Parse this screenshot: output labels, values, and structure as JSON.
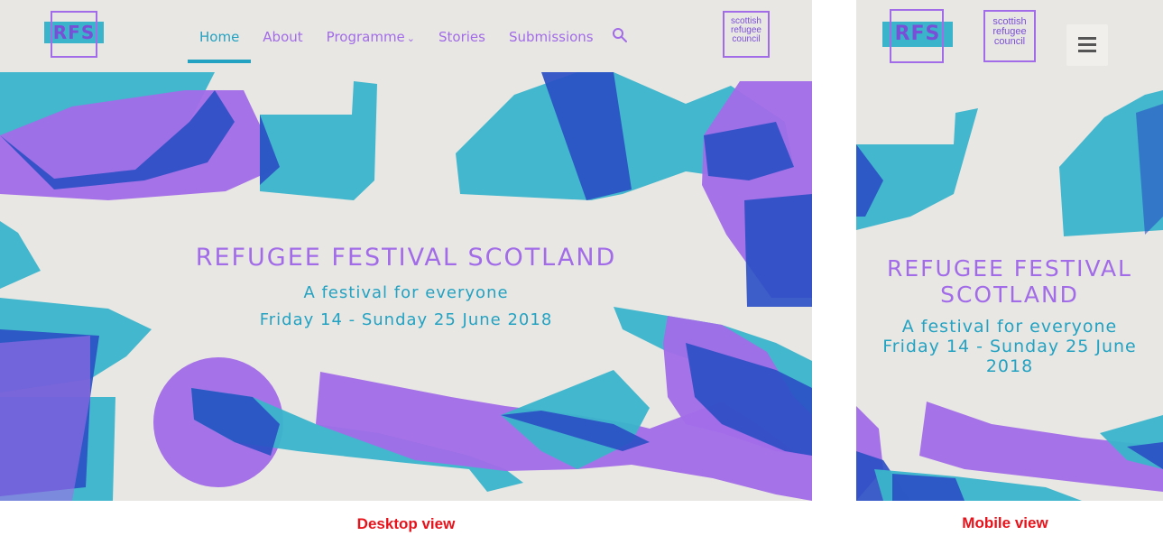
{
  "desktop": {
    "logo_text": "RFS",
    "council_logo": [
      "scottish",
      "refugee",
      "council"
    ],
    "nav": [
      {
        "label": "Home",
        "active": true
      },
      {
        "label": "About",
        "active": false
      },
      {
        "label": "Programme",
        "active": false,
        "has_dropdown": true
      },
      {
        "label": "Stories",
        "active": false
      },
      {
        "label": "Submissions",
        "active": false
      }
    ],
    "search_icon": "search-icon",
    "hero": {
      "title": "REFUGEE FESTIVAL SCOTLAND",
      "tagline": "A festival for everyone",
      "dates": "Friday 14 - Sunday 25 June 2018"
    }
  },
  "mobile": {
    "logo_text": "RFS",
    "council_logo": [
      "scottish",
      "refugee",
      "council"
    ],
    "menu_icon": "hamburger-menu-icon",
    "hero": {
      "title_line1": "REFUGEE FESTIVAL",
      "title_line2": "SCOTLAND",
      "tagline": "A festival for everyone",
      "dates_line1": "Friday 14 - Sunday 25 June",
      "dates_line2": "2018"
    }
  },
  "captions": {
    "desktop": "Desktop view",
    "mobile": "Mobile view"
  },
  "colors": {
    "purple": "#a26ce8",
    "teal": "#3ab4cb",
    "navy": "#2a4fc4",
    "background": "#e9e7e3",
    "caption_red": "#e8121b"
  }
}
